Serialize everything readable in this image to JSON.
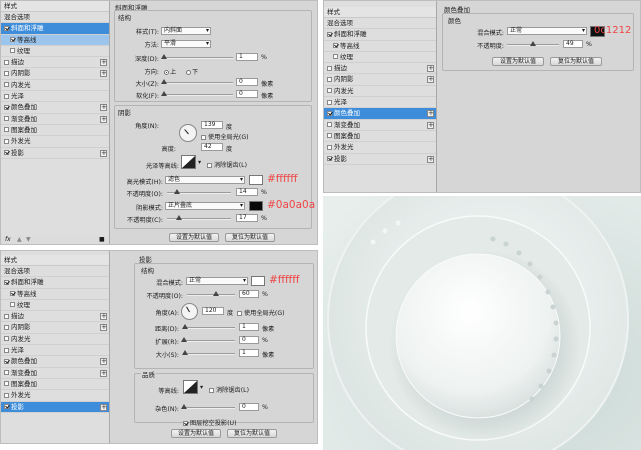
{
  "styles_list": {
    "title": "样式",
    "blend_options": "混合选项",
    "bevel": "斜面和浮雕",
    "contour": "等高线",
    "texture": "纹理",
    "stroke": "描边",
    "inner_shadow": "内阴影",
    "inner_glow": "内发光",
    "satin": "光泽",
    "color_overlay": "颜色叠加",
    "gradient_overlay": "渐变叠加",
    "pattern_overlay": "图案叠加",
    "outer_glow": "外发光",
    "drop_shadow": "投影"
  },
  "panel_bevel": {
    "title": "斜面和浮雕",
    "structure": "结构",
    "style_label": "样式(T):",
    "style_value": "内斜面",
    "technique_label": "方法:",
    "technique_value": "平滑",
    "depth_label": "深度(D):",
    "depth_value": "1",
    "direction_label": "方向:",
    "dir_up": "上",
    "dir_down": "下",
    "size_label": "大小(Z):",
    "size_value": "0",
    "soften_label": "软化(F):",
    "soften_value": "0",
    "shading": "阴影",
    "angle_label": "角度(N):",
    "angle_value": "139",
    "global_light": "使用全局光(G)",
    "altitude_label": "高度:",
    "altitude_value": "42",
    "gloss_label": "光泽等高线:",
    "antialias": "消除锯齿(L)",
    "highlight_label": "高光模式(H):",
    "highlight_value": "滤色",
    "opacity1_label": "不透明度(O):",
    "opacity1_value": "14",
    "shadow_label": "阴影模式:",
    "shadow_value": "正片叠底",
    "opacity2_label": "不透明度(C):",
    "opacity2_value": "17",
    "btn_default": "设置为默认值",
    "btn_reset": "复位为默认值",
    "annotation_highlight": "#ffffff",
    "annotation_shadow": "#0a0a0a",
    "unit_percent": "%",
    "unit_px": "像素",
    "unit_deg": "度"
  },
  "panel_color": {
    "title": "颜色叠加",
    "section": "颜色",
    "blend_label": "混合模式:",
    "blend_value": "正常",
    "opacity_label": "不透明度:",
    "opacity_value": "49",
    "annotation": "0c1212",
    "btn_default": "设置为默认值",
    "btn_reset": "复位为默认值"
  },
  "panel_shadow": {
    "title": "投影",
    "structure": "结构",
    "blend_label": "混合模式:",
    "blend_value": "正常",
    "opacity_label": "不透明度(O):",
    "opacity_value": "60",
    "angle_label": "角度(A):",
    "angle_value": "120",
    "global_light": "使用全局光(G)",
    "distance_label": "距离(D):",
    "distance_value": "1",
    "spread_label": "扩展(R):",
    "spread_value": "0",
    "size_label": "大小(S):",
    "size_value": "1",
    "quality": "品质",
    "contour_label": "等高线:",
    "antialias": "消除锯齿(L)",
    "noise_label": "杂色(N):",
    "noise_value": "0",
    "knockout": "图层挖空投影(U)",
    "btn_default": "设置为默认值",
    "btn_reset": "复位为默认值",
    "annotation": "#ffffff"
  },
  "colors": {
    "selection": "#3d8ddb",
    "annotation_red": "#ef4545",
    "shadow_swatch": "#0a0a0a",
    "color_swatch": "#0c1212"
  }
}
